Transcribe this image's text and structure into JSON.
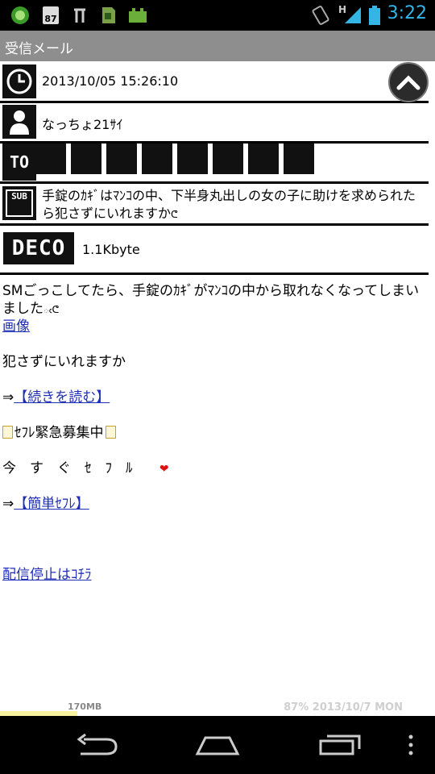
{
  "status_bar": {
    "time": "3:22",
    "notification_badge": "87",
    "signal_label": "H",
    "icons": [
      "app-icon",
      "calendar-badge-icon",
      "usb-icon",
      "sd-card-icon",
      "android-icon",
      "vibrate-icon",
      "signal-icon",
      "battery-icon"
    ]
  },
  "title_bar": {
    "title": "受信メール"
  },
  "header": {
    "datetime": "2013/10/05 15:26:10",
    "sender": "なっちょ21ｻｲ",
    "to_label": "TO",
    "sub_label": "SUB",
    "subject": "手錠のｶｷﾞはﾏﾝｺの中、下半身丸出しの女の子に助けを求められたら犯さずにいれますか",
    "deco_label": "DECO",
    "size": "1.1Kbyte"
  },
  "body": {
    "p1": "SMごっこしてたら、手錠のｶｷﾞがﾏﾝｺの中から取れなくなってしまいました",
    "image_link": "画像",
    "p2": "犯さずにいれますか",
    "arrow1": "⇒",
    "link1": "【続きを読む】",
    "recruit": "ｾﾌﾚ緊急募集中",
    "now": "今　す　ぐ　ｾ　ﾌ　ﾙ",
    "arrow2": "⇒",
    "link2": "【簡単ｾﾌﾚ】",
    "unsubscribe": "配信停止はｺﾁﾗ"
  },
  "footer": {
    "memory": "170MB",
    "battery_date": "87% 2013/10/7 MON"
  },
  "colors": {
    "status_time": "#33b5e5",
    "link": "#1f2fb5",
    "title_bar": "#8e8e8e"
  }
}
